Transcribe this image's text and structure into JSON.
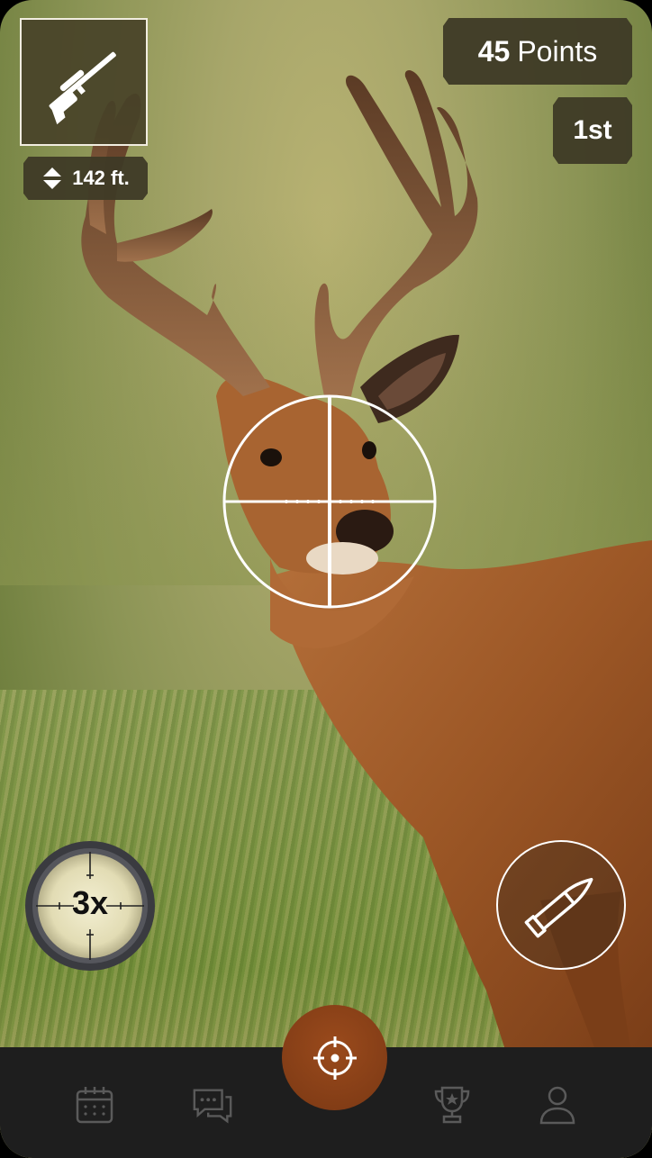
{
  "hud": {
    "weapon_icon": "rifle-icon",
    "range_icon": "up-down-arrows-icon",
    "range_value": "142 ft.",
    "points_value": "45",
    "points_label": "Points",
    "rank": "1st"
  },
  "scope": {
    "zoom_label": "3x",
    "reticle_icon": "crosshair-reticle"
  },
  "actions": {
    "ammo_icon": "bullet-icon",
    "fire_icon": "target-icon"
  },
  "nav": {
    "items": [
      {
        "icon": "calendar-icon"
      },
      {
        "icon": "chat-icon"
      },
      {
        "icon": "trophy-icon"
      },
      {
        "icon": "profile-icon"
      }
    ]
  },
  "colors": {
    "hud_bg": "#3e3a26",
    "fire_button": "#8a4318",
    "nav_bg": "#1e1e1e"
  }
}
